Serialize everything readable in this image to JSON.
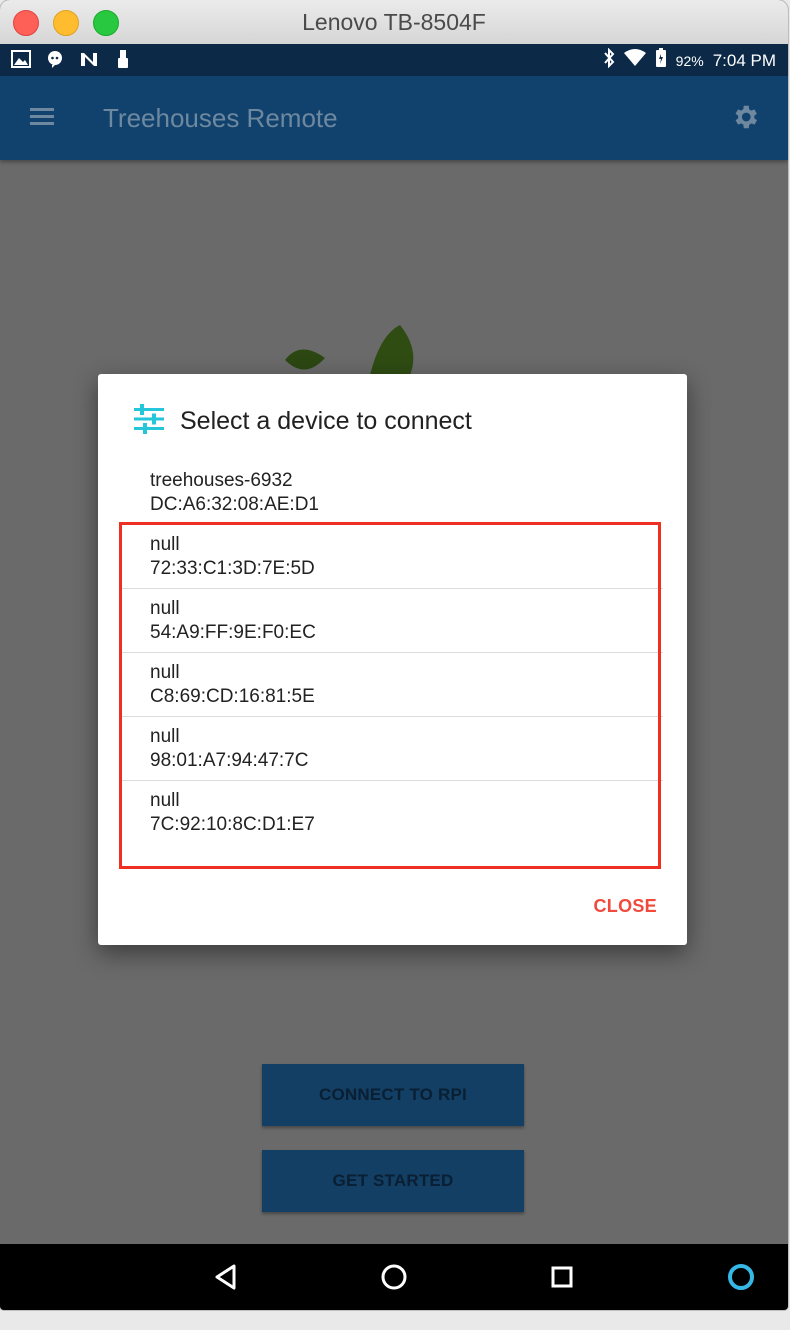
{
  "window": {
    "title": "Lenovo TB-8504F"
  },
  "status_bar": {
    "left_icons": [
      "gallery-icon",
      "chat-icon",
      "n-icon",
      "usb-icon"
    ],
    "battery_percent": "92%",
    "time": "7:04 PM"
  },
  "app_bar": {
    "title": "Treehouses Remote",
    "menu_icon": "hamburger-menu-icon",
    "settings_icon": "gear-icon"
  },
  "main": {
    "connect_label": "CONNECT TO RPI",
    "started_label": "GET STARTED"
  },
  "dialog": {
    "title": "Select a device to connect",
    "icon": "tune-sliders-icon",
    "devices": [
      {
        "name": "treehouses-6932",
        "mac": "DC:A6:32:08:AE:D1"
      },
      {
        "name": "null",
        "mac": "72:33:C1:3D:7E:5D"
      },
      {
        "name": "null",
        "mac": "54:A9:FF:9E:F0:EC"
      },
      {
        "name": "null",
        "mac": "C8:69:CD:16:81:5E"
      },
      {
        "name": "null",
        "mac": "98:01:A7:94:47:7C"
      },
      {
        "name": "null",
        "mac": "7C:92:10:8C:D1:E7"
      }
    ],
    "close_label": "CLOSE"
  },
  "colors": {
    "accent": "#ef4a3c",
    "app_bar": "#11426d",
    "highlight": "#ee3023",
    "icon_teal": "#26c6da"
  }
}
